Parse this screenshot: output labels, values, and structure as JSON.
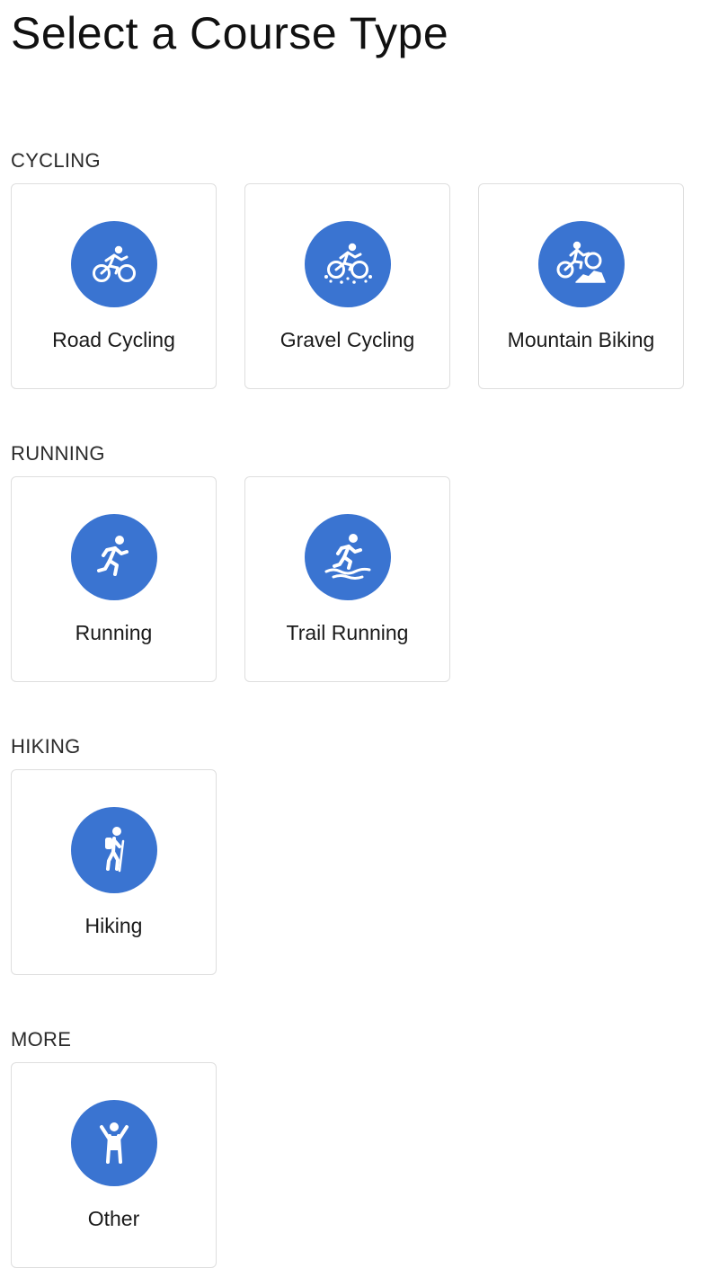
{
  "page_title": "Select a Course Type",
  "accent_color": "#3a74d1",
  "sections": [
    {
      "label": "CYCLING",
      "items": [
        {
          "label": "Road Cycling",
          "icon": "road-cycling-icon"
        },
        {
          "label": "Gravel Cycling",
          "icon": "gravel-cycling-icon"
        },
        {
          "label": "Mountain Biking",
          "icon": "mountain-biking-icon"
        }
      ]
    },
    {
      "label": "RUNNING",
      "items": [
        {
          "label": "Running",
          "icon": "running-icon"
        },
        {
          "label": "Trail Running",
          "icon": "trail-running-icon"
        }
      ]
    },
    {
      "label": "HIKING",
      "items": [
        {
          "label": "Hiking",
          "icon": "hiking-icon"
        }
      ]
    },
    {
      "label": "MORE",
      "items": [
        {
          "label": "Other",
          "icon": "other-activity-icon"
        }
      ]
    }
  ]
}
